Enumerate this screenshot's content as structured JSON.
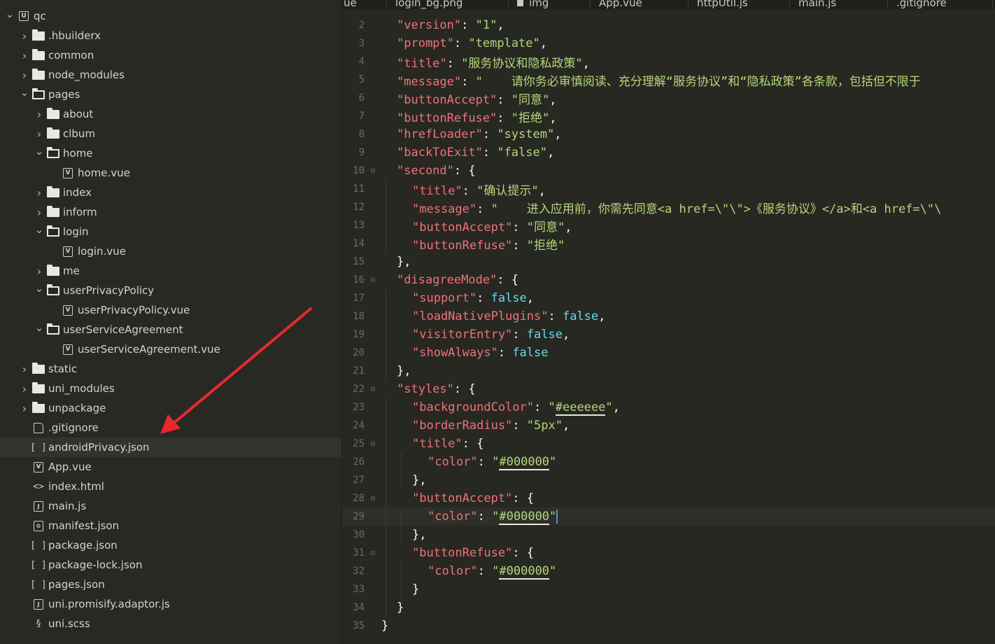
{
  "explorer": {
    "items": [
      {
        "label": "qc",
        "depth": 0,
        "type": "project",
        "chevron": "down"
      },
      {
        "label": ".hbuilderx",
        "depth": 1,
        "type": "folder",
        "chevron": "right"
      },
      {
        "label": "common",
        "depth": 1,
        "type": "folder",
        "chevron": "right"
      },
      {
        "label": "node_modules",
        "depth": 1,
        "type": "folder",
        "chevron": "right"
      },
      {
        "label": "pages",
        "depth": 1,
        "type": "folder-open",
        "chevron": "down"
      },
      {
        "label": "about",
        "depth": 2,
        "type": "folder",
        "chevron": "right"
      },
      {
        "label": "clbum",
        "depth": 2,
        "type": "folder",
        "chevron": "right"
      },
      {
        "label": "home",
        "depth": 2,
        "type": "folder-open",
        "chevron": "down"
      },
      {
        "label": "home.vue",
        "depth": 3,
        "type": "vue",
        "chevron": ""
      },
      {
        "label": "index",
        "depth": 2,
        "type": "folder",
        "chevron": "right"
      },
      {
        "label": "inform",
        "depth": 2,
        "type": "folder",
        "chevron": "right"
      },
      {
        "label": "login",
        "depth": 2,
        "type": "folder-open",
        "chevron": "down"
      },
      {
        "label": "login.vue",
        "depth": 3,
        "type": "vue",
        "chevron": ""
      },
      {
        "label": "me",
        "depth": 2,
        "type": "folder",
        "chevron": "right"
      },
      {
        "label": "userPrivacyPolicy",
        "depth": 2,
        "type": "folder-open",
        "chevron": "down"
      },
      {
        "label": "userPrivacyPolicy.vue",
        "depth": 3,
        "type": "vue",
        "chevron": ""
      },
      {
        "label": "userServiceAgreement",
        "depth": 2,
        "type": "folder-open",
        "chevron": "down"
      },
      {
        "label": "userServiceAgreement.vue",
        "depth": 3,
        "type": "vue",
        "chevron": ""
      },
      {
        "label": "static",
        "depth": 1,
        "type": "folder",
        "chevron": "right"
      },
      {
        "label": "uni_modules",
        "depth": 1,
        "type": "folder",
        "chevron": "right"
      },
      {
        "label": "unpackage",
        "depth": 1,
        "type": "folder",
        "chevron": "right"
      },
      {
        "label": ".gitignore",
        "depth": 1,
        "type": "file",
        "chevron": ""
      },
      {
        "label": "androidPrivacy.json",
        "depth": 1,
        "type": "json",
        "chevron": "",
        "selected": true
      },
      {
        "label": "App.vue",
        "depth": 1,
        "type": "vue",
        "chevron": ""
      },
      {
        "label": "index.html",
        "depth": 1,
        "type": "html",
        "chevron": ""
      },
      {
        "label": "main.js",
        "depth": 1,
        "type": "js",
        "chevron": ""
      },
      {
        "label": "manifest.json",
        "depth": 1,
        "type": "manifest",
        "chevron": ""
      },
      {
        "label": "package.json",
        "depth": 1,
        "type": "json",
        "chevron": ""
      },
      {
        "label": "package-lock.json",
        "depth": 1,
        "type": "json",
        "chevron": ""
      },
      {
        "label": "pages.json",
        "depth": 1,
        "type": "json",
        "chevron": ""
      },
      {
        "label": "uni.promisify.adaptor.js",
        "depth": 1,
        "type": "js",
        "chevron": ""
      },
      {
        "label": "uni.scss",
        "depth": 1,
        "type": "scss",
        "chevron": ""
      }
    ]
  },
  "tabs": [
    {
      "label": "ue"
    },
    {
      "label": "login_bg.png"
    },
    {
      "label": "img",
      "icon": "square"
    },
    {
      "label": "App.vue"
    },
    {
      "label": "httpUtil.js"
    },
    {
      "label": "main.js"
    },
    {
      "label": ".gitignore"
    }
  ],
  "editor": {
    "lines": [
      {
        "n": "2",
        "indent": 1,
        "tokens": [
          [
            "k",
            "\"version\""
          ],
          [
            "p",
            ": "
          ],
          [
            "s",
            "\"1\""
          ],
          [
            "p",
            ","
          ]
        ]
      },
      {
        "n": "3",
        "indent": 1,
        "tokens": [
          [
            "k",
            "\"prompt\""
          ],
          [
            "p",
            ": "
          ],
          [
            "s",
            "\"template\""
          ],
          [
            "p",
            ","
          ]
        ]
      },
      {
        "n": "4",
        "indent": 1,
        "tokens": [
          [
            "k",
            "\"title\""
          ],
          [
            "p",
            ": "
          ],
          [
            "s",
            "\"服务协议和隐私政策\""
          ],
          [
            "p",
            ","
          ]
        ]
      },
      {
        "n": "5",
        "indent": 1,
        "tokens": [
          [
            "k",
            "\"message\""
          ],
          [
            "p",
            ": "
          ],
          [
            "s",
            "\"    请你务必审慎阅读、充分理解“服务协议”和“隐私政策”各条款，包括但不限于"
          ]
        ]
      },
      {
        "n": "6",
        "indent": 1,
        "tokens": [
          [
            "k",
            "\"buttonAccept\""
          ],
          [
            "p",
            ": "
          ],
          [
            "s",
            "\"同意\""
          ],
          [
            "p",
            ","
          ]
        ]
      },
      {
        "n": "7",
        "indent": 1,
        "tokens": [
          [
            "k",
            "\"buttonRefuse\""
          ],
          [
            "p",
            ": "
          ],
          [
            "s",
            "\"拒绝\""
          ],
          [
            "p",
            ","
          ]
        ]
      },
      {
        "n": "8",
        "indent": 1,
        "tokens": [
          [
            "k",
            "\"hrefLoader\""
          ],
          [
            "p",
            ": "
          ],
          [
            "s",
            "\"system\""
          ],
          [
            "p",
            ","
          ]
        ]
      },
      {
        "n": "9",
        "indent": 1,
        "tokens": [
          [
            "k",
            "\"backToExit\""
          ],
          [
            "p",
            ": "
          ],
          [
            "s",
            "\"false\""
          ],
          [
            "p",
            ","
          ]
        ]
      },
      {
        "n": "10",
        "indent": 1,
        "fold": true,
        "tokens": [
          [
            "k",
            "\"second\""
          ],
          [
            "p",
            ": {"
          ]
        ]
      },
      {
        "n": "11",
        "indent": 2,
        "tokens": [
          [
            "k",
            "\"title\""
          ],
          [
            "p",
            ": "
          ],
          [
            "s",
            "\"确认提示\""
          ],
          [
            "p",
            ","
          ]
        ]
      },
      {
        "n": "12",
        "indent": 2,
        "tokens": [
          [
            "k",
            "\"message\""
          ],
          [
            "p",
            ": "
          ],
          [
            "s",
            "\"    进入应用前，你需先同意<a href=\\\"\\\">《服务协议》</a>和<a href=\\\"\\"
          ]
        ]
      },
      {
        "n": "13",
        "indent": 2,
        "tokens": [
          [
            "k",
            "\"buttonAccept\""
          ],
          [
            "p",
            ": "
          ],
          [
            "s",
            "\"同意\""
          ],
          [
            "p",
            ","
          ]
        ]
      },
      {
        "n": "14",
        "indent": 2,
        "tokens": [
          [
            "k",
            "\"buttonRefuse\""
          ],
          [
            "p",
            ": "
          ],
          [
            "s",
            "\"拒绝\""
          ]
        ]
      },
      {
        "n": "15",
        "indent": 1,
        "tokens": [
          [
            "p",
            "},"
          ]
        ]
      },
      {
        "n": "16",
        "indent": 1,
        "fold": true,
        "tokens": [
          [
            "k",
            "\"disagreeMode\""
          ],
          [
            "p",
            ": {"
          ]
        ]
      },
      {
        "n": "17",
        "indent": 2,
        "tokens": [
          [
            "k",
            "\"support\""
          ],
          [
            "p",
            ": "
          ],
          [
            "b",
            "false"
          ],
          [
            "p",
            ","
          ]
        ]
      },
      {
        "n": "18",
        "indent": 2,
        "tokens": [
          [
            "k",
            "\"loadNativePlugins\""
          ],
          [
            "p",
            ": "
          ],
          [
            "b",
            "false"
          ],
          [
            "p",
            ","
          ]
        ]
      },
      {
        "n": "19",
        "indent": 2,
        "tokens": [
          [
            "k",
            "\"visitorEntry\""
          ],
          [
            "p",
            ": "
          ],
          [
            "b",
            "false"
          ],
          [
            "p",
            ","
          ]
        ]
      },
      {
        "n": "20",
        "indent": 2,
        "tokens": [
          [
            "k",
            "\"showAlways\""
          ],
          [
            "p",
            ": "
          ],
          [
            "b",
            "false"
          ]
        ]
      },
      {
        "n": "21",
        "indent": 1,
        "tokens": [
          [
            "p",
            "},"
          ]
        ]
      },
      {
        "n": "22",
        "indent": 1,
        "fold": true,
        "tokens": [
          [
            "k",
            "\"styles\""
          ],
          [
            "p",
            ": {"
          ]
        ]
      },
      {
        "n": "23",
        "indent": 2,
        "tokens": [
          [
            "k",
            "\"backgroundColor\""
          ],
          [
            "p",
            ": "
          ],
          [
            "s",
            "\""
          ],
          [
            "su",
            "#eeeeee"
          ],
          [
            "s",
            "\""
          ],
          [
            "p",
            ","
          ]
        ]
      },
      {
        "n": "24",
        "indent": 2,
        "tokens": [
          [
            "k",
            "\"borderRadius\""
          ],
          [
            "p",
            ": "
          ],
          [
            "s",
            "\"5px\""
          ],
          [
            "p",
            ","
          ]
        ]
      },
      {
        "n": "25",
        "indent": 2,
        "fold": true,
        "tokens": [
          [
            "k",
            "\"title\""
          ],
          [
            "p",
            ": {"
          ]
        ]
      },
      {
        "n": "26",
        "indent": 3,
        "tokens": [
          [
            "k",
            "\"color\""
          ],
          [
            "p",
            ": "
          ],
          [
            "s",
            "\""
          ],
          [
            "su",
            "#000000"
          ],
          [
            "s",
            "\""
          ]
        ]
      },
      {
        "n": "27",
        "indent": 2,
        "tokens": [
          [
            "p",
            "},"
          ]
        ]
      },
      {
        "n": "28",
        "indent": 2,
        "fold": true,
        "tokens": [
          [
            "k",
            "\"buttonAccept\""
          ],
          [
            "p",
            ": {"
          ]
        ]
      },
      {
        "n": "29",
        "indent": 3,
        "active": true,
        "tokens": [
          [
            "k",
            "\"color\""
          ],
          [
            "p",
            ": "
          ],
          [
            "s",
            "\""
          ],
          [
            "su",
            "#000000"
          ],
          [
            "s",
            "\""
          ],
          [
            "cur",
            ""
          ]
        ]
      },
      {
        "n": "30",
        "indent": 2,
        "tokens": [
          [
            "p",
            "},"
          ]
        ]
      },
      {
        "n": "31",
        "indent": 2,
        "fold": true,
        "tokens": [
          [
            "k",
            "\"buttonRefuse\""
          ],
          [
            "p",
            ": {"
          ]
        ]
      },
      {
        "n": "32",
        "indent": 3,
        "tokens": [
          [
            "k",
            "\"color\""
          ],
          [
            "p",
            ": "
          ],
          [
            "s",
            "\""
          ],
          [
            "su",
            "#000000"
          ],
          [
            "s",
            "\""
          ]
        ]
      },
      {
        "n": "33",
        "indent": 2,
        "tokens": [
          [
            "p",
            "}"
          ]
        ]
      },
      {
        "n": "34",
        "indent": 1,
        "tokens": [
          [
            "p",
            "}"
          ]
        ]
      },
      {
        "n": "35",
        "indent": 0,
        "tokens": [
          [
            "p",
            "}"
          ]
        ]
      }
    ]
  },
  "colors": {
    "key": "#f07178",
    "string": "#b5d67a",
    "boolean": "#66d9ef",
    "arrow": "#e8282e"
  }
}
